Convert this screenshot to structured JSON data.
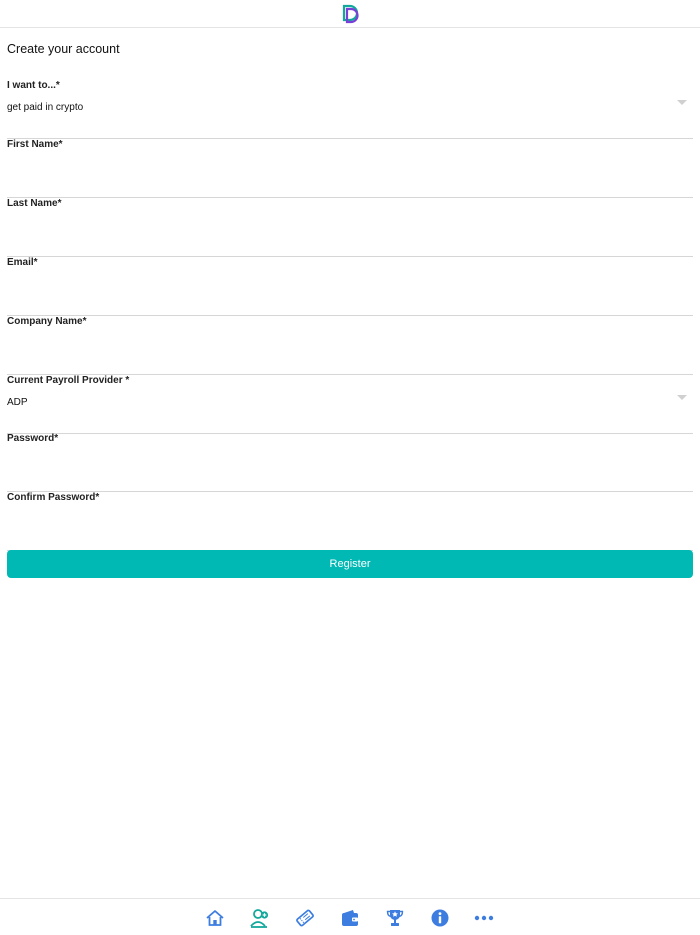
{
  "header": {
    "logo_icon": "brand-d-logo-icon"
  },
  "page": {
    "title": "Create your account"
  },
  "form": {
    "purpose": {
      "label": "I want to...*",
      "value": "get paid in crypto"
    },
    "first_name": {
      "label": "First Name*",
      "value": ""
    },
    "last_name": {
      "label": "Last Name*",
      "value": ""
    },
    "email": {
      "label": "Email*",
      "value": ""
    },
    "company_name": {
      "label": "Company Name*",
      "value": ""
    },
    "payroll_provider": {
      "label": "Current Payroll Provider *",
      "value": "ADP"
    },
    "password": {
      "label": "Password*",
      "value": ""
    },
    "confirm_password": {
      "label": "Confirm Password*",
      "value": ""
    },
    "register_label": "Register"
  },
  "tabbar": {
    "items": [
      {
        "icon": "home-icon"
      },
      {
        "icon": "add-user-icon"
      },
      {
        "icon": "ticket-icon"
      },
      {
        "icon": "wallet-icon"
      },
      {
        "icon": "trophy-icon"
      },
      {
        "icon": "info-icon"
      },
      {
        "icon": "more-icon"
      }
    ]
  },
  "colors": {
    "accent": "#00b8b4",
    "icon_blue": "#3d7de0",
    "icon_teal": "#12a89b",
    "logo_purple": "#7a3fd6"
  }
}
